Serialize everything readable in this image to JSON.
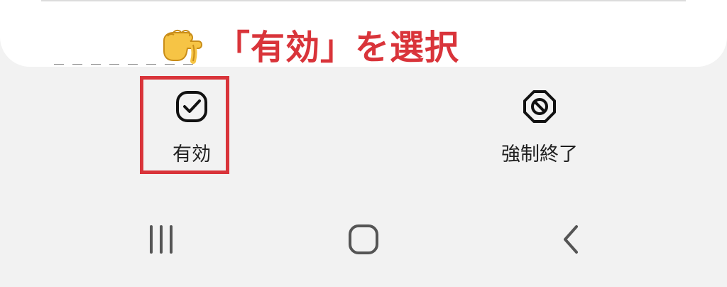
{
  "annotation": {
    "text": "「有効」を選択",
    "icon": "pointing-hand-icon"
  },
  "actions": {
    "enable": {
      "label": "有効",
      "icon": "check-square-icon"
    },
    "force_stop": {
      "label": "強制終了",
      "icon": "block-icon"
    }
  },
  "highlight": {
    "color": "#d9343a"
  },
  "navigation": {
    "recent_icon": "recent-apps-icon",
    "home_icon": "home-icon",
    "back_icon": "back-icon"
  }
}
